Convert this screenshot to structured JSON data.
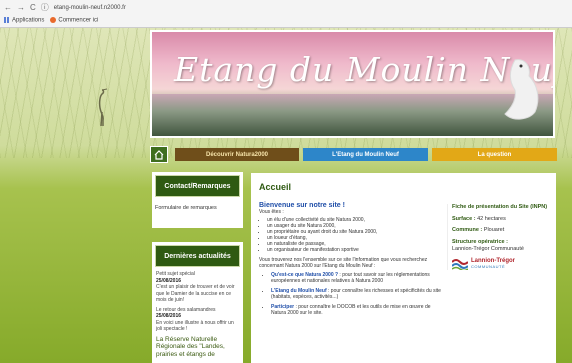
{
  "browser": {
    "nav_back": "←",
    "nav_forward": "→",
    "nav_reload": "C",
    "url": "etang-moulin-neuf.n2000.fr",
    "bookmarks": [
      "Applications",
      "Commencer ici"
    ]
  },
  "banner": {
    "title": "Etang du Moulin Neuf"
  },
  "menu": {
    "home_icon": "home-icon",
    "items": [
      "Découvrir Natura2000",
      "L'Etang du Moulin Neuf",
      "La question"
    ]
  },
  "sidebar": {
    "contact": {
      "title": "Contact/Remarques",
      "link": "Formulaire de remarques"
    },
    "news": {
      "title": "Dernières actualités",
      "items": [
        {
          "title": "Petit sujet spécial",
          "date": "25/08/2016",
          "text": "C'est un plaisir de trouver et de voir que le Damier de la succise en ce mois de juin!"
        },
        {
          "title": "Le retour des salamandres",
          "date": "25/08/2016",
          "text": "En voici une illustre à nous offrir un joli spectacle !"
        }
      ],
      "footer": "La Réserve Naturelle Régionale des \"Landes, prairies et étangs de"
    }
  },
  "main": {
    "title": "Accueil",
    "welcome": "Bienvenue sur notre site !",
    "intro": "Vous êtes :",
    "roles": [
      "un élu d'une collectivité du site Natura 2000,",
      "un usager du site Natura 2000,",
      "un propriétaire ou ayant droit du site Natura 2000,",
      "un loueur d'étang,",
      "un naturaliste de passage,",
      "un organisateur de manifestation sportive"
    ],
    "paragraph": "Vous trouverez nos l'ensemble sur ce site l'information que vous recherchez concernant Natura 2000 sur l'Etang du Moulin Neuf :",
    "links": [
      {
        "bold": "Qu'est-ce que Natura 2000 ?",
        "text": " : pour tout savoir sur les réglementations européennes et nationales relatives à Natura 2000"
      },
      {
        "bold": "L'Etang du Moulin Neuf",
        "text": " : pour connaître les richesses et spécificités du site (habitats, espèces, activités...)"
      },
      {
        "bold": "Participer",
        "text": " : pour connaître le DOCOB et les outils de mise en œuvre de Natura 2000 sur le site."
      }
    ]
  },
  "fiche": {
    "title": "Fiche de présentation du Site (INPN)",
    "surface_label": "Surface :",
    "surface_value": "42 hectares",
    "commune_label": "Commune :",
    "commune_value": "Plouaret",
    "structure_label": "Structure opératrice :",
    "structure_value": "Lannion-Trégor Communauté",
    "logo_name": "Lannion-Trégor",
    "logo_sub": "COMMUNAUTÉ"
  },
  "colors": {
    "menu_brown": "#6f4e1a",
    "menu_blue": "#2d86c9",
    "menu_orange": "#e2a817",
    "dark_green": "#2f5a12"
  }
}
